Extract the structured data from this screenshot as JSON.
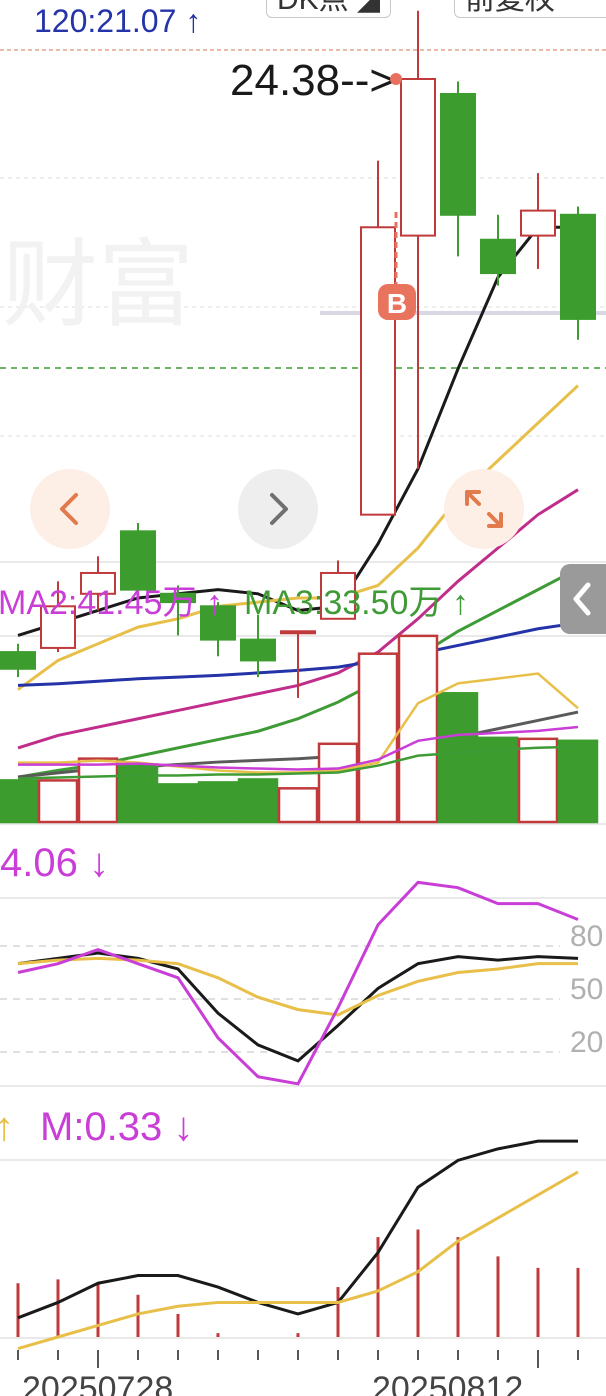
{
  "header": {
    "price_readout": "120:21.07 ↑",
    "mode_button": "DK点",
    "adjust_button": "前复权"
  },
  "watermark": "财富",
  "kline": {
    "max_marker": "24.38-->",
    "buy_marker": "B"
  },
  "nav": {
    "prev_icon": "chevron-left-icon",
    "next_icon": "chevron-right-icon",
    "expand_icon": "expand-icon"
  },
  "volume": {
    "ma2": "MA2:41.45万 ↑",
    "ma3": "MA3:33.50万 ↑"
  },
  "kdj": {
    "value": "4.06 ↓",
    "levels": [
      "80",
      "50",
      "20"
    ]
  },
  "macd": {
    "arrow": "↑",
    "m": "M:0.33 ↓"
  },
  "dates": [
    "20250728",
    "20250812"
  ],
  "colors": {
    "up": "#c0393b",
    "down": "#3c9c2d",
    "ma_black": "#1a1a1a",
    "ma_yellow": "#e8bf48",
    "ma_magenta": "#c12d8a",
    "ma_blue": "#2433a8",
    "ma_green": "#3f9b35",
    "ma_gray": "#5a5a5a",
    "purple": "#c93ed6",
    "label_blue": "#2433a8"
  },
  "chart_data": [
    {
      "type": "candlestick",
      "candles": [
        {
          "o": 17.5,
          "c": 17.3,
          "h": 17.6,
          "l": 17.2
        },
        {
          "o": 17.55,
          "c": 18.05,
          "h": 18.35,
          "l": 17.5
        },
        {
          "o": 18.2,
          "c": 18.45,
          "h": 18.65,
          "l": 18.0
        },
        {
          "o": 18.95,
          "c": 18.25,
          "h": 19.05,
          "l": 18.1
        },
        {
          "o": 18.2,
          "c": 18.1,
          "h": 18.3,
          "l": 17.7
        },
        {
          "o": 18.05,
          "c": 17.65,
          "h": 18.1,
          "l": 17.45
        },
        {
          "o": 17.65,
          "c": 17.4,
          "h": 17.95,
          "l": 17.2
        },
        {
          "o": 17.75,
          "c": 17.75,
          "h": 17.75,
          "l": 16.95
        },
        {
          "o": 17.9,
          "c": 18.45,
          "h": 18.6,
          "l": 17.9
        },
        {
          "o": 19.15,
          "c": 22.6,
          "h": 23.4,
          "l": 19.15
        },
        {
          "o": 22.5,
          "c": 24.38,
          "h": 25.2,
          "l": 19.7
        },
        {
          "o": 24.2,
          "c": 22.75,
          "h": 24.35,
          "l": 22.25
        },
        {
          "o": 22.45,
          "c": 22.05,
          "h": 22.75,
          "l": 21.9
        },
        {
          "o": 22.5,
          "c": 22.8,
          "h": 23.25,
          "l": 22.1
        },
        {
          "o": 22.75,
          "c": 21.5,
          "h": 22.85,
          "l": 21.25
        }
      ],
      "ma": [
        {
          "color": "ma_black",
          "values": [
            17.7,
            17.85,
            18.0,
            18.15,
            18.2,
            18.25,
            18.2,
            18.0,
            18.05,
            18.8,
            19.7,
            20.9,
            22.0,
            22.6,
            22.6
          ]
        },
        {
          "color": "ma_yellow",
          "values": [
            17.05,
            17.4,
            17.6,
            17.8,
            17.9,
            18.05,
            18.1,
            18.15,
            18.15,
            18.3,
            18.75,
            19.35,
            19.8,
            20.25,
            20.7
          ]
        },
        {
          "color": "ma_magenta",
          "values": [
            16.35,
            16.5,
            16.6,
            16.7,
            16.8,
            16.9,
            17.0,
            17.1,
            17.25,
            17.5,
            17.9,
            18.35,
            18.75,
            19.15,
            19.45
          ]
        },
        {
          "color": "ma_blue",
          "values": [
            17.1,
            17.12,
            17.15,
            17.18,
            17.2,
            17.22,
            17.25,
            17.28,
            17.32,
            17.4,
            17.48,
            17.58,
            17.68,
            17.78,
            17.85
          ]
        },
        {
          "color": "ma_green",
          "values": [
            16.0,
            16.08,
            16.15,
            16.25,
            16.35,
            16.45,
            16.55,
            16.7,
            16.9,
            17.15,
            17.45,
            17.75,
            18.0,
            18.25,
            18.5
          ]
        },
        {
          "color": "ma_gray",
          "values": [
            16.0,
            16.05,
            16.1,
            16.12,
            16.15,
            16.18,
            16.2,
            16.22,
            16.25,
            16.32,
            16.4,
            16.48,
            16.58,
            16.68,
            16.78
          ]
        }
      ],
      "max_price": 24.38,
      "buy_signal_index": 10
    },
    {
      "type": "bar",
      "series": [
        {
          "name": "volume",
          "values": [
            42,
            42,
            64,
            58,
            38,
            40,
            43,
            34,
            79,
            170,
            188,
            130,
            85,
            84,
            82
          ]
        },
        {
          "name": "MA2",
          "values": [
            60,
            60,
            62,
            60,
            56,
            52,
            50,
            50,
            52,
            60,
            120,
            140,
            145,
            150,
            115
          ]
        }
      ],
      "ma_curves": [
        {
          "color": "ma_yellow",
          "values": [
            60,
            60,
            62,
            60,
            56,
            52,
            50,
            50,
            52,
            60,
            120,
            140,
            145,
            150,
            115
          ]
        },
        {
          "color": "purple",
          "values": [
            58,
            58,
            58,
            59,
            57,
            55,
            54,
            53,
            54,
            63,
            82,
            88,
            90,
            92,
            96
          ]
        },
        {
          "color": "ma_green",
          "values": [
            44,
            45,
            46,
            47,
            47,
            48,
            48,
            49,
            50,
            57,
            67,
            70,
            73,
            75,
            76
          ]
        }
      ]
    },
    {
      "type": "line",
      "series": [
        {
          "color": "ma_black",
          "values": [
            70,
            73,
            76,
            73,
            67,
            42,
            24,
            15,
            35,
            56,
            70,
            74,
            72,
            74,
            73
          ]
        },
        {
          "color": "ma_yellow",
          "values": [
            70,
            72,
            73,
            72,
            70,
            62,
            51,
            44,
            41,
            52,
            60,
            65,
            67,
            70,
            70
          ]
        },
        {
          "color": "purple",
          "values": [
            65,
            70,
            78,
            70,
            62,
            28,
            6,
            2,
            45,
            92,
            116,
            113,
            104,
            104,
            95
          ]
        }
      ],
      "levels": [
        80,
        50,
        20
      ]
    },
    {
      "type": "line",
      "series": [
        {
          "color": "ma_black",
          "values": [
            0.05,
            0.09,
            0.14,
            0.16,
            0.16,
            0.13,
            0.09,
            0.06,
            0.09,
            0.22,
            0.39,
            0.46,
            0.49,
            0.51,
            0.51
          ]
        },
        {
          "color": "ma_yellow",
          "values": [
            -0.03,
            0.0,
            0.03,
            0.06,
            0.08,
            0.09,
            0.09,
            0.09,
            0.09,
            0.12,
            0.17,
            0.25,
            0.31,
            0.37,
            0.43
          ]
        }
      ],
      "hist": [
        0.14,
        0.15,
        0.14,
        0.11,
        0.06,
        0.01,
        0.0,
        0.01,
        0.13,
        0.26,
        0.28,
        0.26,
        0.21,
        0.18,
        0.18
      ]
    }
  ]
}
